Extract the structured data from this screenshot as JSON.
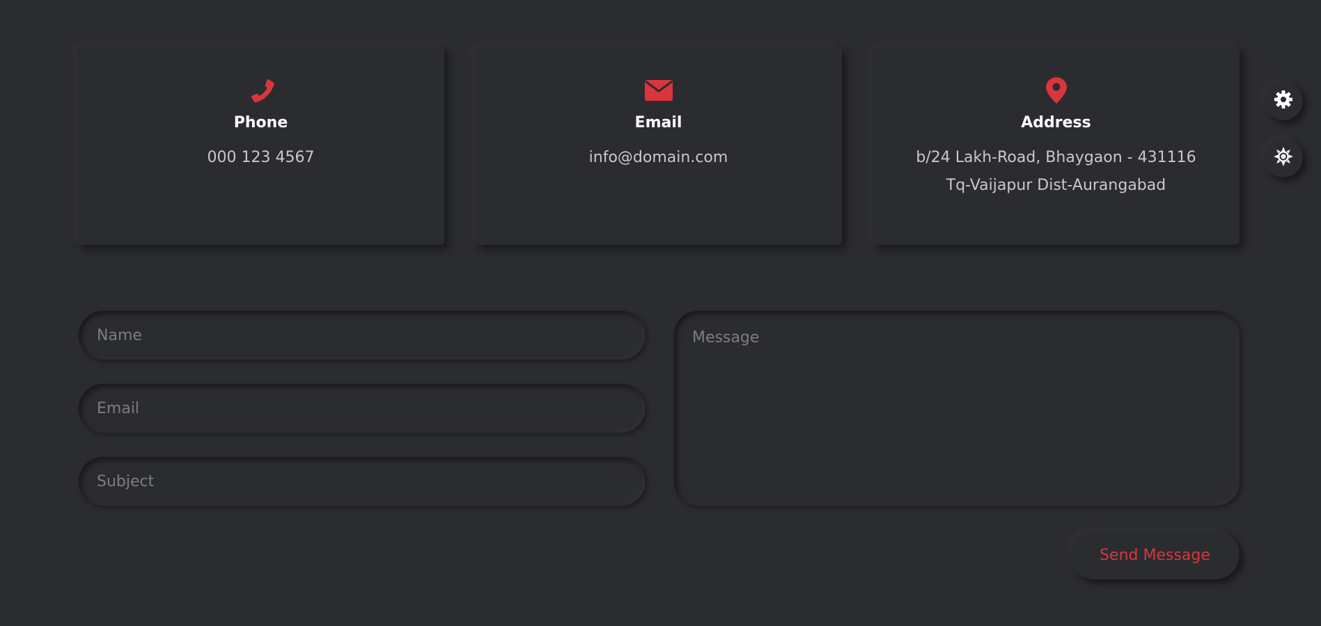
{
  "colors": {
    "background": "#2b2c30",
    "accent": "#d9363c",
    "heading": "#ffffff",
    "text": "#c9c9cc",
    "placeholder": "#7c7d82"
  },
  "contact_cards": [
    {
      "icon": "phone-icon",
      "title": "Phone",
      "lines": [
        "000 123 4567"
      ]
    },
    {
      "icon": "envelope-icon",
      "title": "Email",
      "lines": [
        "info@domain.com"
      ]
    },
    {
      "icon": "map-pin-icon",
      "title": "Address",
      "lines": [
        "b/24 Lakh-Road, Bhaygaon - 431116",
        "Tq-Vaijapur Dist-Aurangabad"
      ]
    }
  ],
  "side_buttons": [
    {
      "icon": "gear-icon"
    },
    {
      "icon": "sun-icon"
    }
  ],
  "form": {
    "name_placeholder": "Name",
    "email_placeholder": "Email",
    "subject_placeholder": "Subject",
    "message_placeholder": "Message",
    "submit_label": "Send Message"
  }
}
